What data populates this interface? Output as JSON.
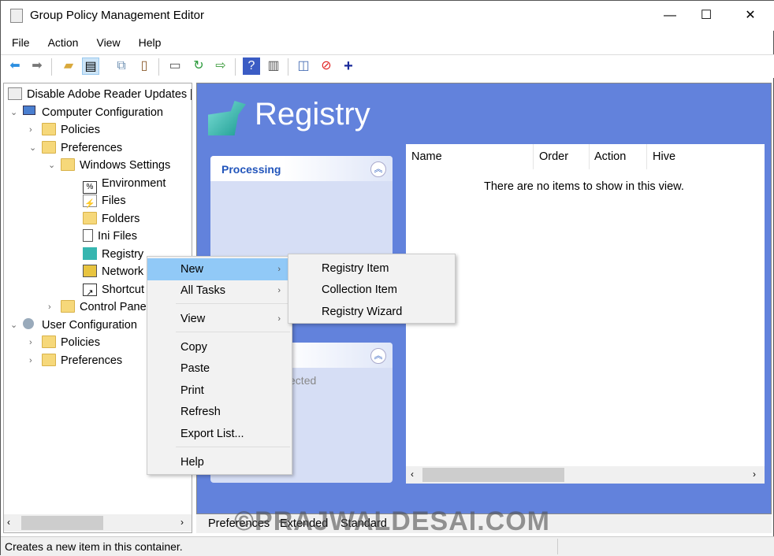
{
  "window": {
    "title": "Group Policy Management Editor",
    "minimize": "—",
    "maximize": "☐",
    "close": "✕"
  },
  "menubar": [
    "File",
    "Action",
    "View",
    "Help"
  ],
  "toolbar": [
    "back-icon",
    "forward-icon",
    "up-folder-icon",
    "show-hide-tree-icon",
    "copy-icon",
    "paste-icon",
    "print-icon",
    "refresh-icon",
    "export-list-icon",
    "help-icon",
    "show-hide-action-pane-icon",
    "properties-icon",
    "stop-icon",
    "add-icon"
  ],
  "tree": {
    "root": "Disable Adobe Reader Updates [",
    "computer": "Computer Configuration",
    "policies": "Policies",
    "preferences": "Preferences",
    "windows_settings": "Windows Settings",
    "items": [
      "Environment",
      "Files",
      "Folders",
      "Ini Files",
      "Registry",
      "Network",
      "Shortcut"
    ],
    "control_panel": "Control Pane",
    "user": "User Configuration",
    "user_policies": "Policies",
    "user_preferences": "Preferences"
  },
  "main": {
    "title": "Registry",
    "processing": "Processing",
    "description_placeholder": "No item selected",
    "columns": [
      "Name",
      "Order",
      "Action",
      "Hive"
    ],
    "empty": "There are no items to show in this view.",
    "tabs": [
      "Preferences",
      "Extended",
      "Standard"
    ]
  },
  "context_menu": {
    "items": [
      "New",
      "All Tasks",
      "View",
      "Copy",
      "Paste",
      "Print",
      "Refresh",
      "Export List...",
      "Help"
    ]
  },
  "submenu": {
    "items": [
      "Registry Item",
      "Collection Item",
      "Registry Wizard"
    ]
  },
  "status": "Creates a new item in this container.",
  "watermark": "©PRAJWALDESAI.COM",
  "colors": {
    "pane_blue": "#6282dc",
    "menu_highlight": "#91c9f7",
    "panel_title": "#2255bb"
  }
}
